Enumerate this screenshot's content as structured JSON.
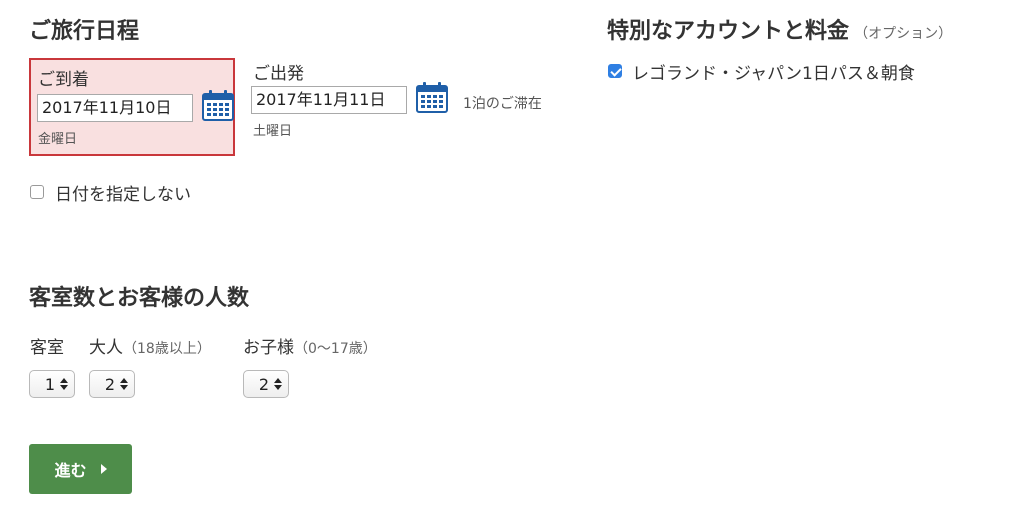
{
  "itinerary": {
    "heading": "ご旅行日程",
    "arrival": {
      "label": "ご到着",
      "date": "2017年11月10日",
      "weekday": "金曜日"
    },
    "departure": {
      "label": "ご出発",
      "date": "2017年11月11日",
      "weekday": "土曜日"
    },
    "stay_text": "1泊のご滞在",
    "no_dates_label": "日付を指定しない",
    "no_dates_checked": false
  },
  "special": {
    "heading": "特別なアカウントと料金",
    "optional": "（オプション）",
    "legoland_label": "レゴランド・ジャパン1日パス＆朝食",
    "legoland_checked": true
  },
  "rooms": {
    "heading": "客室数とお客様の人数",
    "rooms_label": "客室",
    "adults_label": "大人",
    "adults_note": "（18歳以上）",
    "children_label": "お子様",
    "children_note": "（0〜17歳）",
    "rooms_value": "1",
    "adults_value": "2",
    "children_value": "2"
  },
  "proceed_label": "進む",
  "colors": {
    "error_bg": "#f9e0e0",
    "error_border": "#c9373b",
    "button": "#4e8d4a",
    "checkbox": "#2f7fe3",
    "calendar": "#1f5fa8"
  },
  "icons": {
    "calendar": "calendar-icon",
    "select_arrows": "up-down-arrows-icon",
    "proceed": "chevron-right-icon"
  }
}
